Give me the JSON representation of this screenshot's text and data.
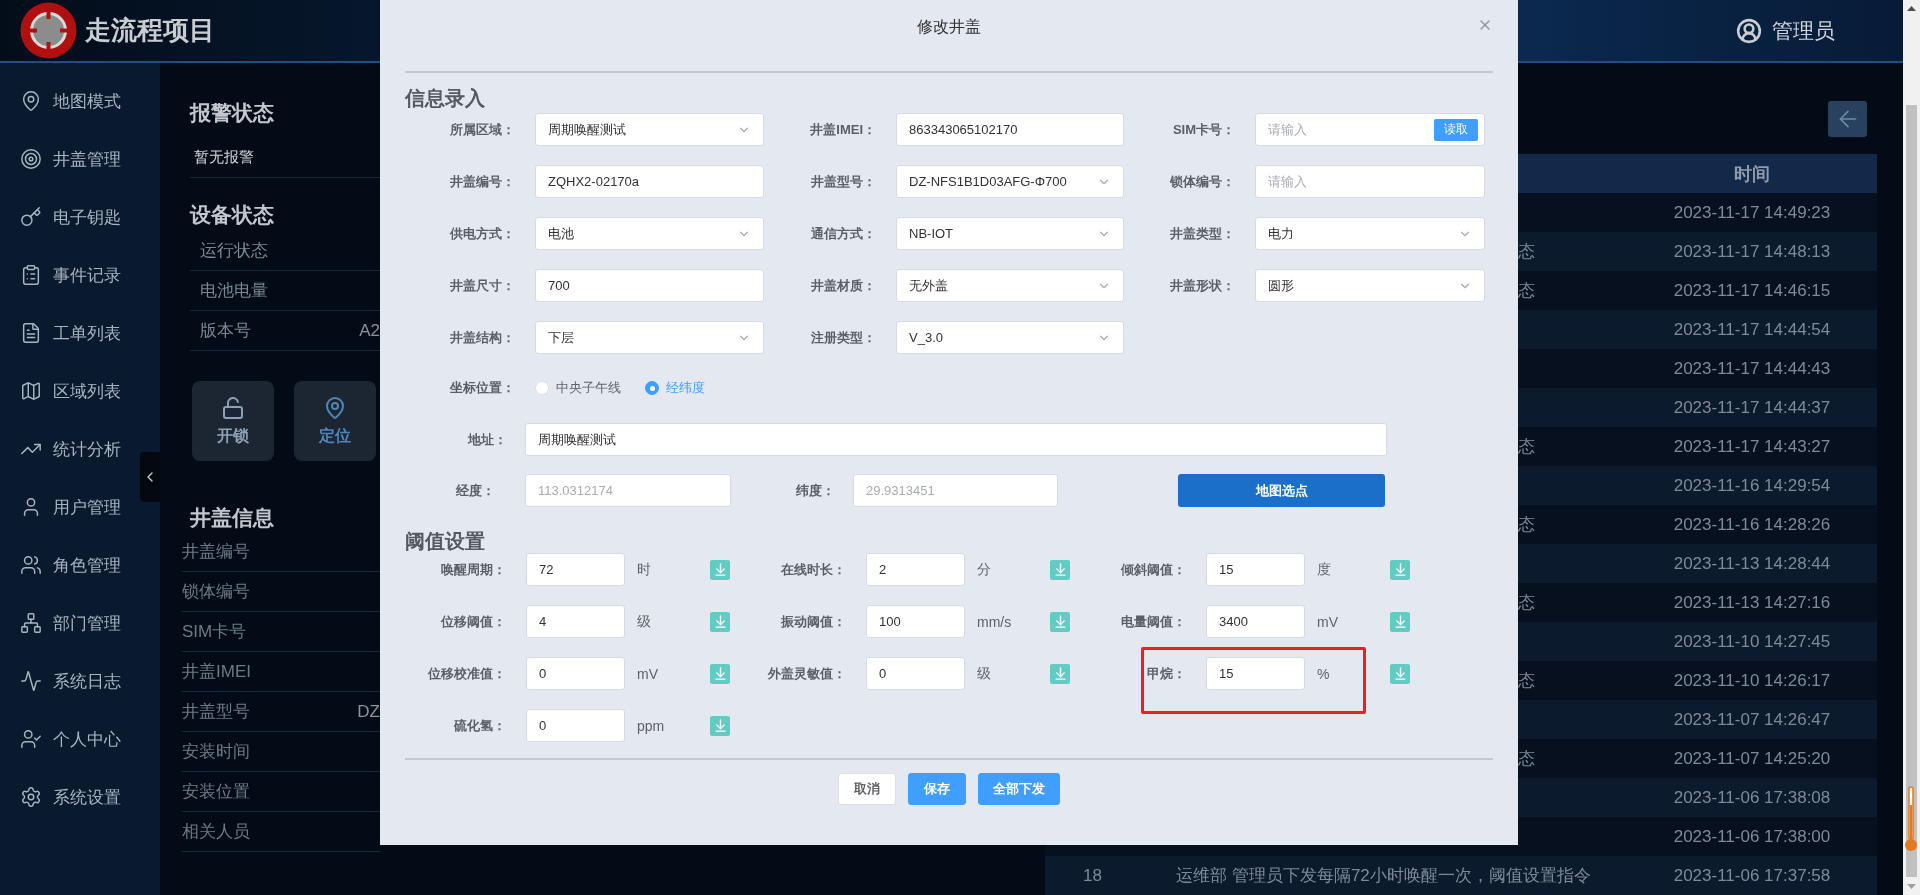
{
  "app": {
    "title": "走流程项目",
    "user": "管理员"
  },
  "sidebar": {
    "items": [
      {
        "label": "地图模式"
      },
      {
        "label": "井盖管理"
      },
      {
        "label": "电子钥匙"
      },
      {
        "label": "事件记录"
      },
      {
        "label": "工单列表"
      },
      {
        "label": "区域列表"
      },
      {
        "label": "统计分析"
      },
      {
        "label": "用户管理"
      },
      {
        "label": "角色管理"
      },
      {
        "label": "部门管理"
      },
      {
        "label": "系统日志"
      },
      {
        "label": "个人中心"
      },
      {
        "label": "系统设置"
      }
    ]
  },
  "alarm_panel": {
    "title": "报警状态",
    "message": "暂无报警"
  },
  "device_status": {
    "title": "设备状态",
    "rows": [
      {
        "label": "运行状态"
      },
      {
        "label": "电池电量"
      },
      {
        "label": "版本号",
        "value": "A2"
      }
    ]
  },
  "actions": [
    {
      "label": "开锁",
      "kind": "unlock"
    },
    {
      "label": "定位",
      "kind": "locate"
    }
  ],
  "cover_info": {
    "title": "井盖信息",
    "rows": [
      {
        "label": "井盖编号"
      },
      {
        "label": "锁体编号"
      },
      {
        "label": "SIM卡号"
      },
      {
        "label": "井盖IMEI"
      },
      {
        "label": "井盖型号",
        "value": "DZ"
      },
      {
        "label": "安装时间"
      },
      {
        "label": "安装位置"
      },
      {
        "label": "相关人员"
      }
    ]
  },
  "events_table": {
    "time_column_title": "时间",
    "rows": [
      {
        "kind": "time_only",
        "time": "2023-11-17 14:49:23"
      },
      {
        "kind": "fragment",
        "content": "态",
        "time": "2023-11-17 14:48:13"
      },
      {
        "kind": "fragment",
        "content": "态",
        "time": "2023-11-17 14:46:15"
      },
      {
        "kind": "time_only",
        "time": "2023-11-17 14:44:54"
      },
      {
        "kind": "time_only",
        "time": "2023-11-17 14:44:43"
      },
      {
        "kind": "time_only",
        "time": "2023-11-17 14:44:37"
      },
      {
        "kind": "fragment",
        "content": "态",
        "time": "2023-11-17 14:43:27"
      },
      {
        "kind": "time_only",
        "time": "2023-11-16 14:29:54"
      },
      {
        "kind": "fragment",
        "content": "态",
        "time": "2023-11-16 14:28:26"
      },
      {
        "kind": "time_only",
        "time": "2023-11-13 14:28:44"
      },
      {
        "kind": "fragment",
        "content": "态",
        "time": "2023-11-13 14:27:16"
      },
      {
        "kind": "time_only",
        "time": "2023-11-10 14:27:45"
      },
      {
        "kind": "fragment",
        "content": "态",
        "time": "2023-11-10 14:26:17"
      },
      {
        "kind": "time_only",
        "time": "2023-11-07 14:26:47"
      },
      {
        "kind": "fragment",
        "content": "态",
        "time": "2023-11-07 14:25:20"
      },
      {
        "kind": "time_only",
        "time": "2023-11-06 17:38:08"
      },
      {
        "kind": "time_only",
        "time": "2023-11-06 17:38:00"
      },
      {
        "kind": "full",
        "index": "18",
        "content": "运维部 管理员下发每隔72小时唤醒一次，阈值设置指令",
        "time": "2023-11-06 17:37:58"
      }
    ]
  },
  "dialog": {
    "title": "修改井盖",
    "info_section": {
      "title": "信息录入",
      "rows": [
        [
          {
            "label": "所属区域：",
            "kind": "select",
            "value": "周期唤醒测试"
          },
          {
            "label": "井盖IMEI：",
            "kind": "text",
            "value": "863343065102170"
          },
          {
            "label": "SIM卡号：",
            "kind": "text_button",
            "placeholder": "请输入",
            "button": "读取"
          }
        ],
        [
          {
            "label": "井盖编号：",
            "kind": "text",
            "value": "ZQHX2-02170a"
          },
          {
            "label": "井盖型号：",
            "kind": "select",
            "value": "DZ-NFS1B1D03AFG-Φ700"
          },
          {
            "label": "锁体编号：",
            "kind": "text",
            "placeholder": "请输入"
          }
        ],
        [
          {
            "label": "供电方式：",
            "kind": "select",
            "value": "电池"
          },
          {
            "label": "通信方式：",
            "kind": "select",
            "value": "NB-IOT"
          },
          {
            "label": "井盖类型：",
            "kind": "select",
            "value": "电力"
          }
        ],
        [
          {
            "label": "井盖尺寸：",
            "kind": "text",
            "value": "700"
          },
          {
            "label": "井盖材质：",
            "kind": "select",
            "value": "无外盖"
          },
          {
            "label": "井盖形状：",
            "kind": "select",
            "value": "圆形"
          }
        ],
        [
          {
            "label": "井盖结构：",
            "kind": "select",
            "value": "下层"
          },
          {
            "label": "注册类型：",
            "kind": "select",
            "value": "V_3.0"
          }
        ]
      ]
    },
    "coordinate": {
      "label": "坐标位置：",
      "options": [
        {
          "label": "中央子午线",
          "selected": false
        },
        {
          "label": "经纬度",
          "selected": true
        }
      ]
    },
    "address": {
      "label": "地址：",
      "value": "周期唤醒测试"
    },
    "longitude": {
      "label": "经度：",
      "value": "113.0312174",
      "disabled": true
    },
    "latitude": {
      "label": "纬度：",
      "value": "29.9313451",
      "disabled": true
    },
    "map_button": "地图选点",
    "threshold_section": {
      "title": "阈值设置",
      "rows": [
        [
          {
            "label": "唤醒周期：",
            "value": "72",
            "unit": "时",
            "highlighted": false
          },
          {
            "label": "在线时长：",
            "value": "2",
            "unit": "分",
            "highlighted": false
          },
          {
            "label": "倾斜阈值：",
            "value": "15",
            "unit": "度",
            "highlighted": false
          }
        ],
        [
          {
            "label": "位移阈值：",
            "value": "4",
            "unit": "级",
            "highlighted": false
          },
          {
            "label": "振动阈值：",
            "value": "100",
            "unit": "mm/s",
            "highlighted": false
          },
          {
            "label": "电量阈值：",
            "value": "3400",
            "unit": "mV",
            "highlighted": false
          }
        ],
        [
          {
            "label": "位移校准值：",
            "value": "0",
            "unit": "mV",
            "highlighted": false
          },
          {
            "label": "外盖灵敏值：",
            "value": "0",
            "unit": "级",
            "highlighted": false
          },
          {
            "label": "甲烷：",
            "value": "15",
            "unit": "%",
            "highlighted": true
          }
        ],
        [
          {
            "label": "硫化氢：",
            "value": "0",
            "unit": "ppm",
            "highlighted": false
          }
        ]
      ]
    },
    "buttons": [
      {
        "label": "取消",
        "kind": "default"
      },
      {
        "label": "保存",
        "kind": "primary"
      },
      {
        "label": "全部下发",
        "kind": "primary"
      }
    ]
  }
}
